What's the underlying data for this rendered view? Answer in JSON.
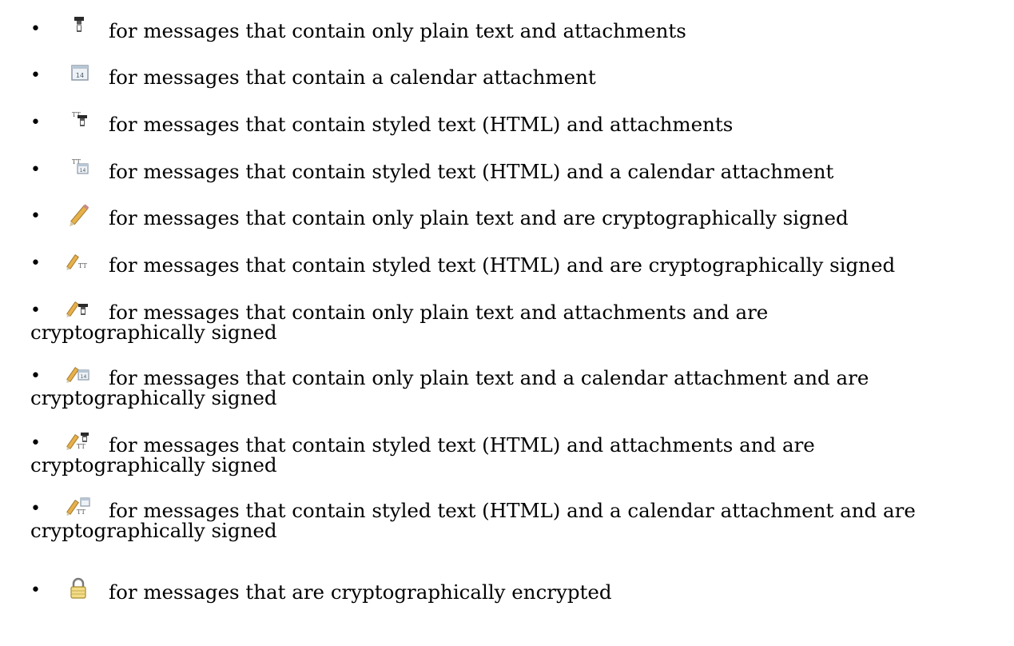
{
  "items": [
    {
      "icon": "plain-text-attachment-icon",
      "text": "for messages that contain only plain text and attachments"
    },
    {
      "icon": "calendar-icon",
      "text": "for messages that contain a calendar attachment"
    },
    {
      "icon": "styled-text-attachment-icon",
      "text": "for messages that contain styled text (HTML) and attachments"
    },
    {
      "icon": "styled-text-calendar-icon",
      "text": "for messages that contain styled text (HTML) and a calendar attachment"
    },
    {
      "icon": "pencil-signed-icon",
      "text": "for messages that contain only plain text and are cryptographically signed"
    },
    {
      "icon": "pencil-styled-text-icon",
      "text": "for messages that contain styled text (HTML) and are cryptographically signed"
    },
    {
      "icon": "pencil-attachment-icon",
      "line1": "for messages that contain only plain text and attachments and are",
      "line2": "cryptographically signed"
    },
    {
      "icon": "pencil-calendar-icon",
      "line1": "for messages that contain only plain text and a calendar attachment and are",
      "line2": "cryptographically signed"
    },
    {
      "icon": "pencil-styled-attachment-icon",
      "line1": "for messages that contain styled text (HTML) and attachments and are",
      "line2": "cryptographically signed"
    },
    {
      "icon": "pencil-styled-calendar-icon",
      "line1": "for messages that contain styled text (HTML) and a calendar attachment and are",
      "line2": "cryptographically signed"
    },
    {
      "icon": "lock-encrypted-icon",
      "text": "for messages that are cryptographically encrypted"
    }
  ],
  "bullet": "•"
}
